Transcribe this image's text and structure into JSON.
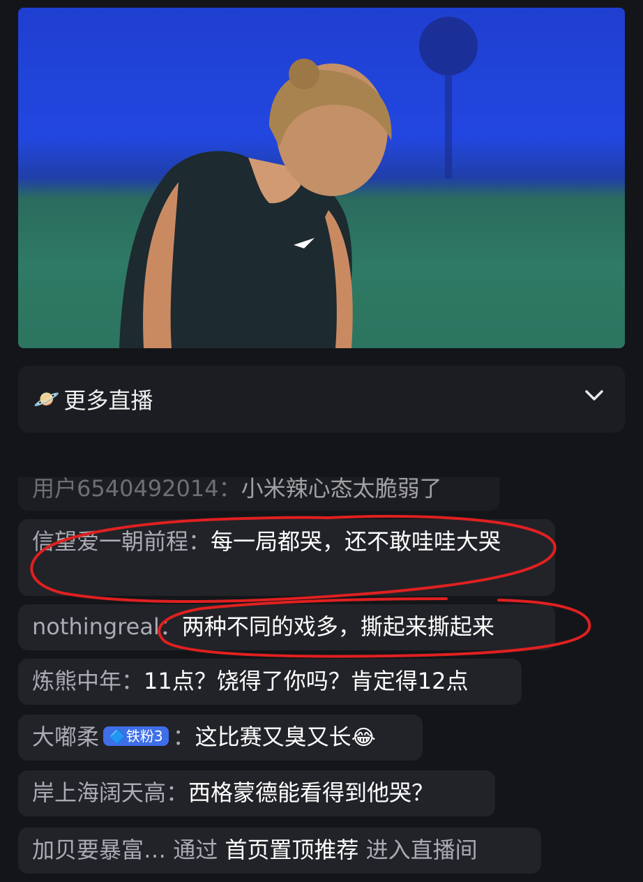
{
  "more_live": {
    "icon": "planet-icon",
    "label": "更多直播"
  },
  "comments": [
    {
      "user": "用户6540492014：",
      "text": "小米辣心态太脆弱了"
    },
    {
      "user": "信望爱一朝前程：",
      "text": "每一局都哭，还不敢哇哇大哭"
    },
    {
      "user": "nothingreal：",
      "text": "两种不同的戏多，撕起来撕起来"
    },
    {
      "user": "炼熊中年：",
      "text": "11点？饶得了你吗？肯定得12点"
    },
    {
      "user": "大嘟柔",
      "badge": "🔷铁粉3",
      "sep": "：",
      "text": "这比赛又臭又长",
      "emoji": "😂"
    },
    {
      "user": "岸上海阔天高：",
      "text": "西格蒙德能看得到他哭？"
    }
  ],
  "system_msg": {
    "user": "加贝要暴富… ",
    "pre": "通过 ",
    "highlight": "首页置顶推荐",
    "post": " 进入直播间"
  },
  "colors": {
    "background": "#141519",
    "card": "#222328",
    "username": "#a9acb3",
    "annotation": "#e02020"
  }
}
